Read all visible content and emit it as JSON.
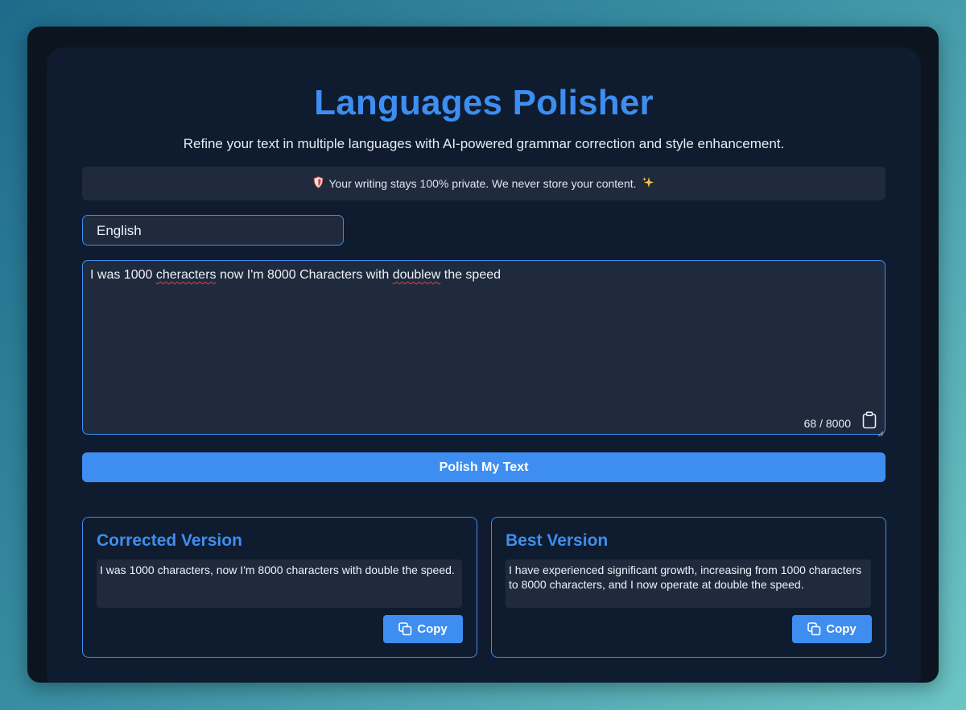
{
  "app": {
    "title": "Languages Polisher",
    "subtitle": "Refine your text in multiple languages with AI-powered grammar correction and style enhancement."
  },
  "privacy": {
    "text": "Your writing stays 100% private. We never store your content.",
    "leading_icon": "shield-icon",
    "trailing_icon": "sparkles-icon"
  },
  "language_select": {
    "value": "English"
  },
  "editor": {
    "segments": [
      {
        "text": "I was 1000 ",
        "misspelled": false
      },
      {
        "text": "cheracters",
        "misspelled": true
      },
      {
        "text": " now I'm 8000 Characters with ",
        "misspelled": false
      },
      {
        "text": "doublew",
        "misspelled": true
      },
      {
        "text": " the speed",
        "misspelled": false
      }
    ],
    "char_count": "68 / 8000"
  },
  "polish_button": {
    "label": "Polish My Text"
  },
  "results": [
    {
      "heading": "Corrected Version",
      "text": "I was 1000 characters, now I'm 8000 characters with double the speed.",
      "copy_label": "Copy"
    },
    {
      "heading": "Best Version",
      "text": "I have experienced significant growth, increasing from 1000 characters to 8000 characters, and I now operate at double the speed.",
      "copy_label": "Copy"
    }
  ],
  "colors": {
    "accent": "#3d8ef0",
    "panel": "#1f2a3d",
    "card": "#0f1b2e",
    "window": "#0c1420",
    "spellcheck": "#e0404a"
  }
}
